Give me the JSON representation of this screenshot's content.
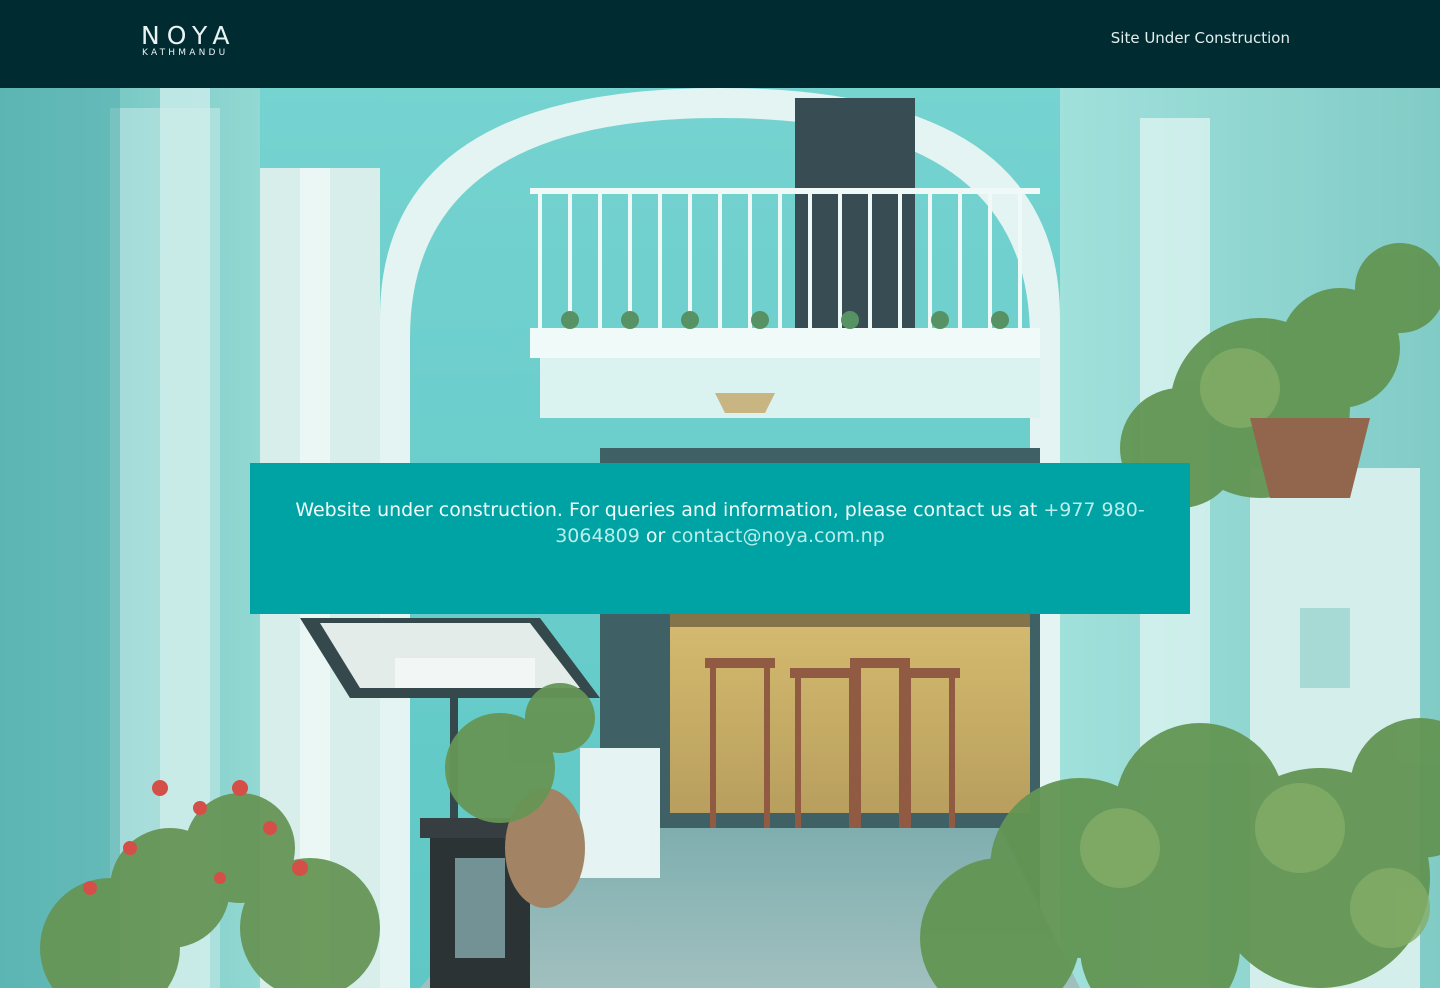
{
  "header": {
    "logo_main": "NOYA",
    "logo_sub": "KATHMANDU",
    "nav_link": "Site Under Construction",
    "background_color": "#002b31"
  },
  "notice": {
    "text_before": "Website under construction. For queries and information, please contact us at ",
    "phone": "+977 980-3064809",
    "text_between": " or ",
    "email": "contact@noya.com.np",
    "background_color": "#00a3a3"
  }
}
